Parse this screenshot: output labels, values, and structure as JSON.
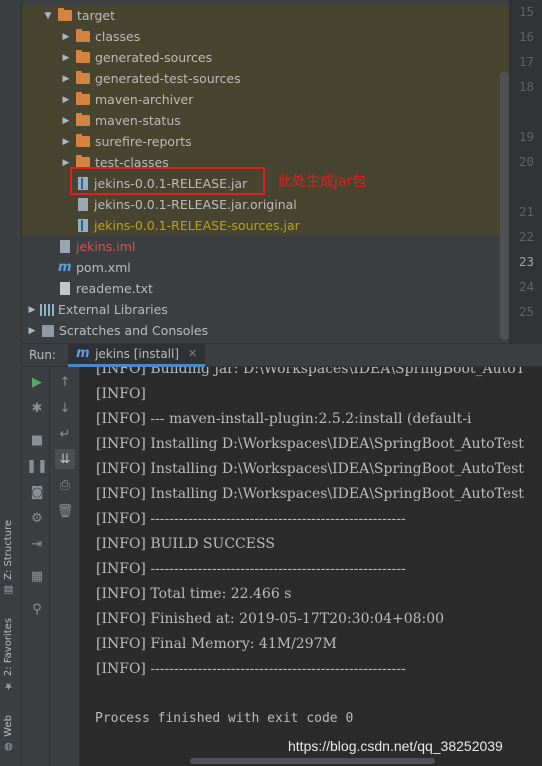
{
  "project_tree": {
    "target": "target",
    "folders": [
      "classes",
      "generated-sources",
      "generated-test-sources",
      "maven-archiver",
      "maven-status",
      "surefire-reports",
      "test-classes"
    ],
    "jar_file": "jekins-0.0.1-RELEASE.jar",
    "jar_original": "jekins-0.0.1-RELEASE.jar.original",
    "sources_jar": "jekins-0.0.1-RELEASE-sources.jar",
    "iml_file": "jekins.iml",
    "pom_file": "pom.xml",
    "readme_file": "reademe.txt",
    "external_libraries": "External Libraries",
    "scratches": "Scratches and Consoles"
  },
  "annotation": {
    "text": "此处生成jar包",
    "color": "#e02020"
  },
  "gutter": {
    "lines": [
      "15",
      "16",
      "17",
      "18",
      "19",
      "20",
      "21",
      "22",
      "23",
      "24",
      "25"
    ],
    "current_line": "23"
  },
  "run_panel": {
    "label": "Run:",
    "tab_label": "jekins [install]"
  },
  "console_lines": [
    "[INFO] Building jar: D:\\Workspaces\\IDEA\\SpringBoot_AutoT",
    "[INFO]",
    "[INFO] --- maven-install-plugin:2.5.2:install (default-i",
    "[INFO] Installing D:\\Workspaces\\IDEA\\SpringBoot_AutoTest",
    "[INFO] Installing D:\\Workspaces\\IDEA\\SpringBoot_AutoTest",
    "[INFO] Installing D:\\Workspaces\\IDEA\\SpringBoot_AutoTest",
    "[INFO] ------------------------------------------------------",
    "[INFO] BUILD SUCCESS",
    "[INFO] ------------------------------------------------------",
    "[INFO] Total time: 22.466 s",
    "[INFO] Finished at: 2019-05-17T20:30:04+08:00",
    "[INFO] Final Memory: 41M/297M",
    "[INFO] ------------------------------------------------------"
  ],
  "exit_message": "Process finished with exit code 0",
  "side_tabs": {
    "structure": "Z: Structure",
    "favorites": "2: Favorites",
    "web": "Web"
  },
  "watermark": "https://blog.csdn.net/qq_38252039",
  "colors": {
    "accent": "#4a88c7",
    "run_green": "#59a869",
    "highlight_row": "#47452f"
  }
}
